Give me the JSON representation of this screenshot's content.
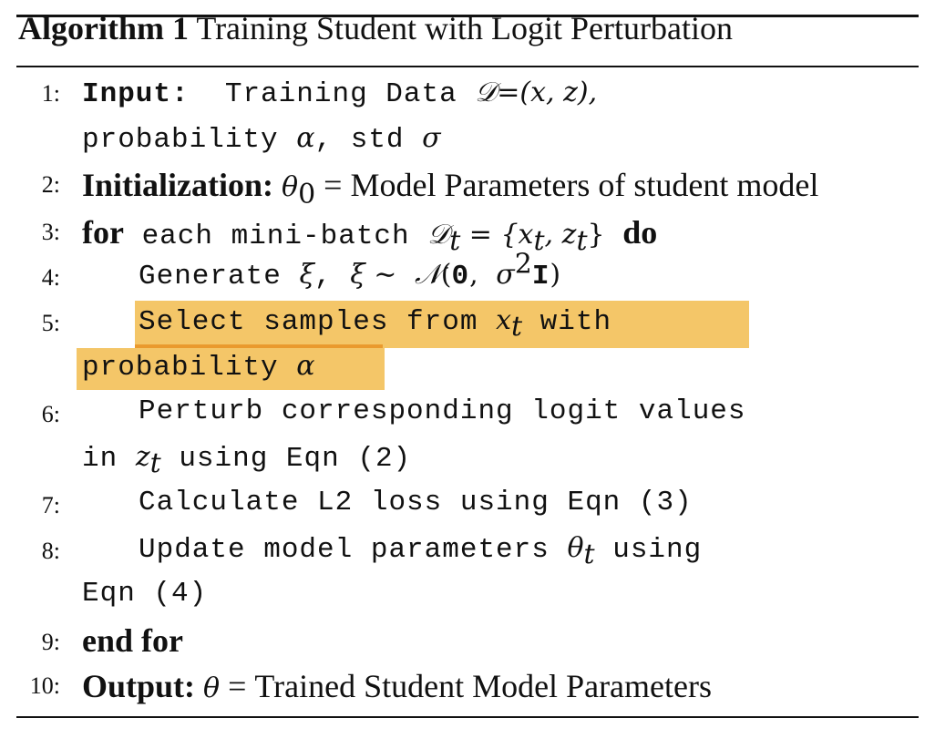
{
  "algorithm": {
    "label": "Algorithm 1",
    "title": "Training Student with Logit Perturbation"
  },
  "lines": {
    "l1": {
      "num": "1:",
      "kw": "Input:",
      "text": "Training Data",
      "math": "𝒟=(x, z),",
      "cont": "probability",
      "alpha": "α",
      "std": ", std",
      "sigma": "σ"
    },
    "l2": {
      "num": "2:",
      "kw": "Initialization:",
      "theta": "θ",
      "sub": "0",
      "text": "= Model Parameters of student model"
    },
    "l3": {
      "num": "3:",
      "kw": "for",
      "text": "each mini-batch",
      "D": "𝒟",
      "sub": "t",
      "eq": " = ",
      "set": "{x",
      "set_sub1": "t",
      "set_mid": ", z",
      "set_sub2": "t",
      "set_end": "}",
      "do": "do"
    },
    "l4": {
      "num": "4:",
      "text": "Generate",
      "xi": "ξ",
      "comma": ",",
      "xi2": "ξ ∼",
      "N": "𝒩",
      "open": "(",
      "zero": "0",
      "comma2": ",",
      "sig": "σ",
      "sup": "2",
      "I": "I",
      "close": ")"
    },
    "l5": {
      "num": "5:",
      "text": "Select samples from",
      "x": "x",
      "sub": "t",
      "with": "with",
      "cont": "probability",
      "alpha": "α"
    },
    "l6": {
      "num": "6:",
      "text": "Perturb corresponding logit values",
      "cont_in": "in",
      "z": "z",
      "sub": "t",
      "cont_rest": "using Eqn (2)"
    },
    "l7": {
      "num": "7:",
      "text": "Calculate L2 loss using Eqn (3)"
    },
    "l8": {
      "num": "8:",
      "text": "Update model parameters",
      "theta": "θ",
      "sub": "t",
      "using": "using",
      "cont": "Eqn (4)"
    },
    "l9": {
      "num": "9:",
      "kw": "end for"
    },
    "l10": {
      "num": "10:",
      "kw": "Output:",
      "theta": "θ",
      "text": "= Trained Student Model Parameters"
    }
  },
  "colors": {
    "highlight": "#f4c668",
    "highlight_underline": "#ea9a2e",
    "text": "#111111"
  }
}
